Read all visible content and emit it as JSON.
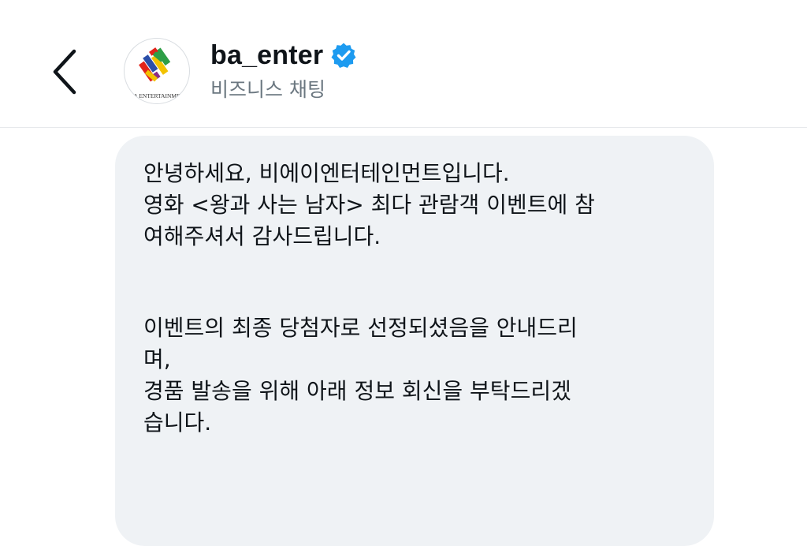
{
  "header": {
    "back_icon": "chevron-left-icon",
    "avatar": {
      "icon": "ba-entertainment-logo",
      "logo_text": "B A ENTERTAINMENT",
      "colors": [
        "#e2231a",
        "#2b4ea8",
        "#f2c200",
        "#2e9e47",
        "#8b2c86"
      ]
    },
    "account_name": "ba_enter",
    "verified_icon": "verified-badge-icon",
    "verified_color": "#1d9bf0",
    "subtitle": "비즈니스 채팅"
  },
  "message": {
    "paragraph1": [
      "안녕하세요, 비에이엔터테인먼트입니다.",
      "영화 <왕과 사는 남자> 최다 관람객 이벤트에 참",
      "여해주셔서 감사드립니다."
    ],
    "paragraph2": [
      "이벤트의 최종 당첨자로 선정되셨음을 안내드리",
      "며,",
      "경품 발송을 위해 아래 정보 회신을 부탁드리겠",
      "습니다."
    ]
  }
}
